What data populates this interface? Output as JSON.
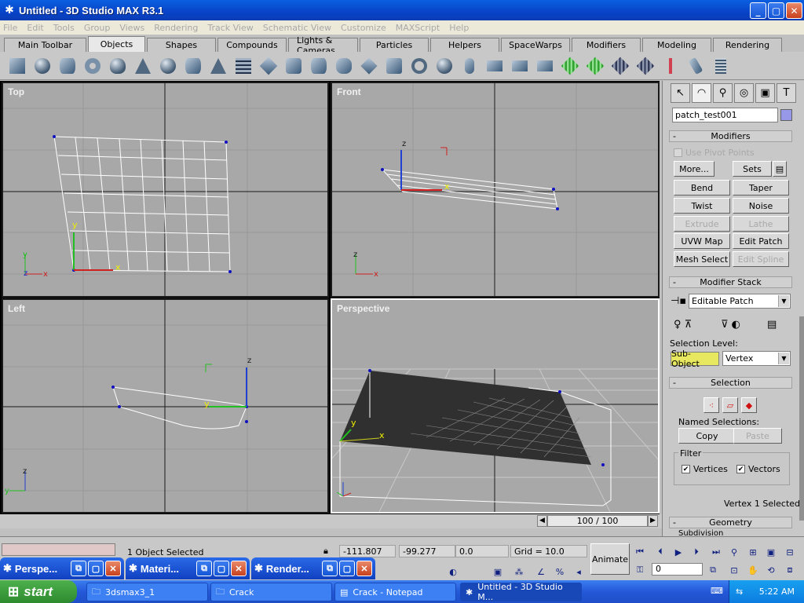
{
  "window": {
    "title": "Untitled - 3D Studio MAX R3.1",
    "minimize": "_",
    "maximize": "▢",
    "close": "✕"
  },
  "menu": [
    "File",
    "Edit",
    "Tools",
    "Group",
    "Views",
    "Rendering",
    "Track View",
    "Schematic View",
    "Customize",
    "MAXScript",
    "Help"
  ],
  "tabs": [
    "Main Toolbar",
    "Objects",
    "Shapes",
    "Compounds",
    "Lights & Cameras",
    "Particles",
    "Helpers",
    "SpaceWarps",
    "Modifiers",
    "Modeling",
    "Rendering"
  ],
  "active_tab": "Objects",
  "toolbar_icons": [
    "box-icon",
    "sphere-icon",
    "cylinder-icon",
    "torus-icon",
    "teapot-icon",
    "cone-icon",
    "geosphere-icon",
    "tube-icon",
    "pyramid-icon",
    "plane-grid-icon",
    "hedra-icon",
    "chamfer-box-icon",
    "chamfer-cyl-icon",
    "oil-tank-icon",
    "spindle-icon",
    "gengon-icon",
    "ring-wave-icon",
    "torus-knot-icon",
    "capsule-icon",
    "l-ext-icon",
    "c-ext-icon",
    "prism-icon",
    "quad-patch-icon",
    "tri-patch-icon",
    "nurbs-surface-icon",
    "cv-surface-icon",
    "bones-icon",
    "prefab-icon",
    "spring-icon"
  ],
  "viewports": {
    "top": "Top",
    "front": "Front",
    "left": "Left",
    "perspective": "Perspective"
  },
  "command_panel": {
    "tab_icons": [
      "create-icon",
      "modify-icon",
      "hierarchy-icon",
      "motion-icon",
      "display-icon",
      "utilities-icon"
    ],
    "object_name": "patch_test001",
    "object_color": "#9898e8",
    "modifiers_title": "Modifiers",
    "use_pivot_points": "Use Pivot Points",
    "more": "More...",
    "sets": "Sets",
    "buttons": [
      "Bend",
      "Taper",
      "Twist",
      "Noise",
      "Extrude",
      "Lathe",
      "UVW Map",
      "Edit Patch",
      "Mesh Select",
      "Edit Spline"
    ],
    "modifier_stack_title": "Modifier Stack",
    "stack_value": "Editable Patch",
    "selection_level_label": "Selection Level:",
    "sub_object": "Sub-Object",
    "sub_object_value": "Vertex",
    "selection_title": "Selection",
    "named_selections_label": "Named Selections:",
    "copy": "Copy",
    "paste": "Paste",
    "filter_label": "Filter",
    "vertices": "Vertices",
    "vectors": "Vectors",
    "vertex_selected": "Vertex 1 Selected",
    "geometry_title": "Geometry",
    "subdivision_label": "Subdivision"
  },
  "time_slider": {
    "value": "100 / 100"
  },
  "status": {
    "selected": "1 Object Selected",
    "x": "-111.807",
    "y": "-99.277",
    "z": "0.0",
    "grid": "Grid = 10.0",
    "animate": "Animate",
    "frame": "0"
  },
  "mdi_windows": [
    {
      "label": "Perspe...",
      "icon": "max-icon"
    },
    {
      "label": "Materi...",
      "icon": "max-icon"
    },
    {
      "label": "Render...",
      "icon": "max-icon"
    }
  ],
  "taskbar": {
    "start": "start",
    "items": [
      {
        "label": "3dsmax3_1",
        "icon": "folder-icon"
      },
      {
        "label": "Crack",
        "icon": "folder-icon"
      },
      {
        "label": "Crack - Notepad",
        "icon": "notepad-icon"
      },
      {
        "label": "Untitled - 3D Studio M...",
        "icon": "max-icon"
      }
    ],
    "clock": "5:22 AM"
  }
}
